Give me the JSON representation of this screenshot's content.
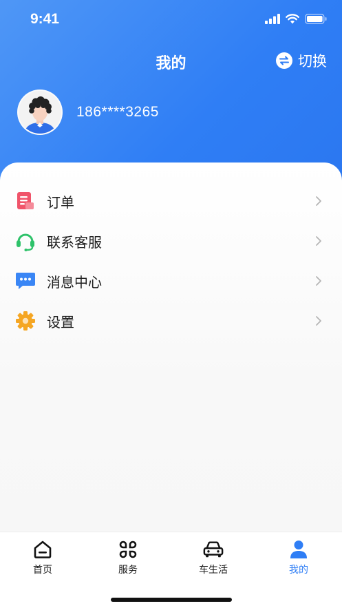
{
  "status_bar": {
    "time": "9:41"
  },
  "header": {
    "title": "我的",
    "switch_label": "切换"
  },
  "profile": {
    "phone": "186****3265"
  },
  "menu": [
    {
      "label": "订单",
      "icon": "order-icon",
      "color": "#f0546a"
    },
    {
      "label": "联系客服",
      "icon": "headset-icon",
      "color": "#2ec26a"
    },
    {
      "label": "消息中心",
      "icon": "message-icon",
      "color": "#3a86f5"
    },
    {
      "label": "设置",
      "icon": "gear-icon",
      "color": "#f5a623"
    }
  ],
  "tabbar": {
    "items": [
      {
        "label": "首页",
        "icon": "home-icon"
      },
      {
        "label": "服务",
        "icon": "grid-icon"
      },
      {
        "label": "车生活",
        "icon": "car-icon"
      },
      {
        "label": "我的",
        "icon": "person-icon",
        "active": true
      }
    ]
  },
  "colors": {
    "brand": "#2f7ef5",
    "header_gradient_start": "#4f97f6"
  }
}
